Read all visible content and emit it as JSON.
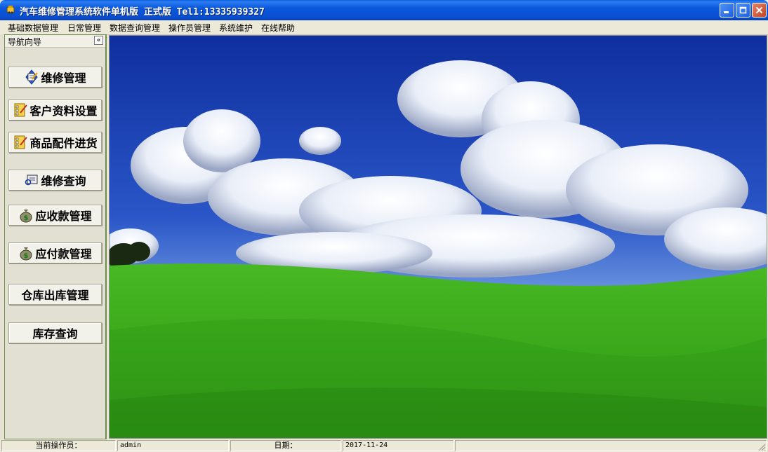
{
  "window": {
    "title": "汽车维修管理系统软件单机版 正式版 Tel1:13335939327"
  },
  "menu": [
    {
      "label": "基础数据管理"
    },
    {
      "label": "日常管理"
    },
    {
      "label": "数据查询管理"
    },
    {
      "label": "操作员管理"
    },
    {
      "label": "系统维护"
    },
    {
      "label": "在线帮助"
    }
  ],
  "nav": {
    "header": "导航向导",
    "collapse": "«",
    "buttons": [
      {
        "label": "维修管理",
        "icon": "repair-notebook-icon"
      },
      {
        "label": "客户资料设置",
        "icon": "customer-form-icon"
      },
      {
        "label": "商品配件进货",
        "icon": "purchase-form-icon"
      },
      {
        "label": "维修查询",
        "icon": "query-card-icon"
      },
      {
        "label": "应收款管理",
        "icon": "money-bag-icon"
      },
      {
        "label": "应付款管理",
        "icon": "money-bag-icon"
      },
      {
        "label": "仓库出库管理",
        "icon": ""
      },
      {
        "label": "库存查询",
        "icon": ""
      }
    ]
  },
  "status": {
    "operator_label": "当前操作员：",
    "operator_value": "admin",
    "date_label": "日期：",
    "date_value": "2017-11-24"
  },
  "colors": {
    "sky": "#1a3fb8",
    "grass": "#3fae1e",
    "titlebar": "#0a54d8"
  }
}
